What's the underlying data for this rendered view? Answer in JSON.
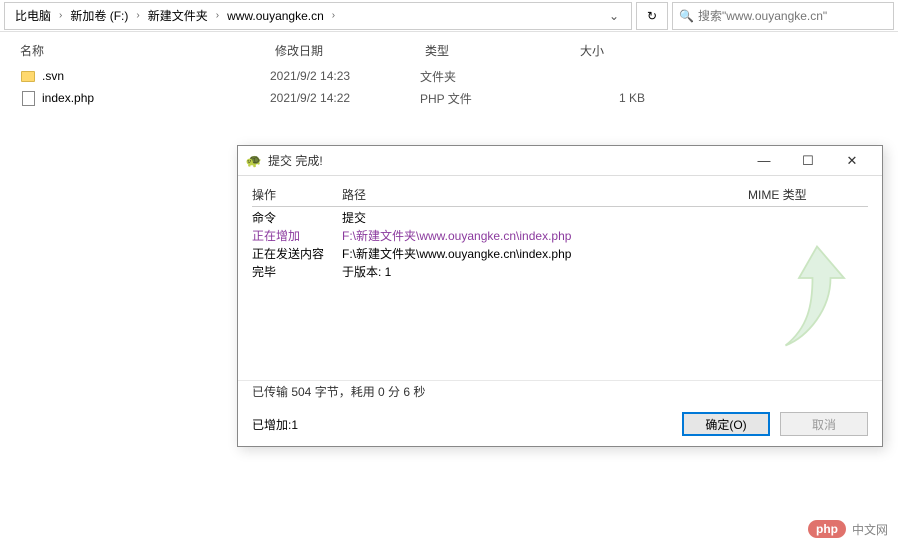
{
  "breadcrumb": {
    "items": [
      "比电脑",
      "新加卷 (F:)",
      "新建文件夹",
      "www.ouyangke.cn"
    ]
  },
  "search": {
    "placeholder": "搜索\"www.ouyangke.cn\""
  },
  "columns": {
    "name": "名称",
    "date": "修改日期",
    "type": "类型",
    "size": "大小"
  },
  "files": [
    {
      "icon": "folder",
      "name": ".svn",
      "date": "2021/9/2 14:23",
      "type": "文件夹",
      "size": ""
    },
    {
      "icon": "php",
      "name": "index.php",
      "date": "2021/9/2 14:22",
      "type": "PHP 文件",
      "size": "1 KB"
    }
  ],
  "dialog": {
    "title": "提交 完成!",
    "headers": {
      "op": "操作",
      "path": "路径",
      "mime": "MIME 类型"
    },
    "rows": [
      {
        "op": "命令",
        "path": "提交",
        "style": ""
      },
      {
        "op": "正在增加",
        "path": "F:\\新建文件夹\\www.ouyangke.cn\\index.php",
        "style": "purple"
      },
      {
        "op": "正在发送内容",
        "path": "F:\\新建文件夹\\www.ouyangke.cn\\index.php",
        "style": ""
      },
      {
        "op": "完毕",
        "path": "于版本: 1",
        "style": ""
      }
    ],
    "transfer": "已传输 504 字节，耗用 0 分 6 秒",
    "added": "已增加:1",
    "ok": "确定(O)",
    "cancel": "取消"
  },
  "watermark": {
    "badge": "php",
    "text": "中文网"
  }
}
